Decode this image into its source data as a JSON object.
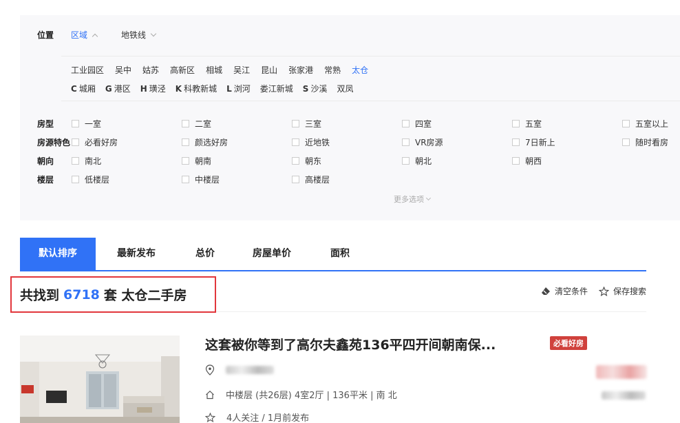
{
  "location": {
    "label": "位置",
    "tabs": [
      {
        "label": "区域",
        "active": true
      },
      {
        "label": "地铁线",
        "active": false
      }
    ],
    "districts": [
      "工业园区",
      "吴中",
      "姑苏",
      "高新区",
      "相城",
      "吴江",
      "昆山",
      "张家港",
      "常熟",
      "太仓"
    ],
    "selected_district": "太仓",
    "lettered": [
      {
        "letter": "C",
        "name": "城厢"
      },
      {
        "letter": "G",
        "name": "港区"
      },
      {
        "letter": "H",
        "name": "璜泾"
      },
      {
        "letter": "K",
        "name": "科教新城"
      },
      {
        "letter": "L",
        "name": "浏河"
      },
      {
        "letter": "",
        "name": "娄江新城"
      },
      {
        "letter": "S",
        "name": "沙溪"
      },
      {
        "letter": "",
        "name": "双凤"
      }
    ]
  },
  "filters": [
    {
      "label": "房型",
      "options": [
        "一室",
        "二室",
        "三室",
        "四室",
        "五室",
        "五室以上"
      ]
    },
    {
      "label": "房源特色",
      "options": [
        "必看好房",
        "颜选好房",
        "近地铁",
        "VR房源",
        "7日新上",
        "随时看房"
      ]
    },
    {
      "label": "朝向",
      "options": [
        "南北",
        "朝南",
        "朝东",
        "朝北",
        "朝西"
      ]
    },
    {
      "label": "楼层",
      "options": [
        "低楼层",
        "中楼层",
        "高楼层"
      ]
    }
  ],
  "more_options": "更多选项",
  "sort_tabs": [
    "默认排序",
    "最新发布",
    "总价",
    "房屋单价",
    "面积"
  ],
  "result": {
    "prefix": "共找到",
    "count": "6718",
    "suffix": "套 太仓二手房"
  },
  "actions": {
    "clear": "清空条件",
    "save": "保存搜索"
  },
  "listing": {
    "title": "这套被你等到了高尔夫鑫苑136平四开间朝南保...",
    "tag": "必看好房",
    "house_info": "中楼层 (共26层) 4室2厅 | 136平米 | 南 北",
    "follow_info": "4人关注 / 1月前发布"
  },
  "colors": {
    "accent": "#3072f6",
    "highlight_border": "#e2363b",
    "tag_bg": "#d0413c"
  }
}
